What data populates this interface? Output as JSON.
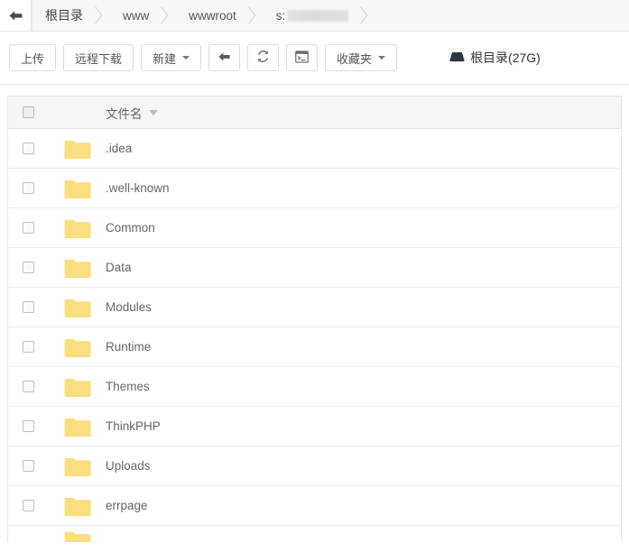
{
  "breadcrumb": {
    "back_icon": "arrow-left-icon",
    "items": [
      {
        "label": "根目录",
        "redacted": false
      },
      {
        "label": "www",
        "redacted": false
      },
      {
        "label": "wwwroot",
        "redacted": false
      },
      {
        "label": "s:",
        "redacted": true
      }
    ]
  },
  "toolbar": {
    "upload_label": "上传",
    "remote_download_label": "远程下载",
    "new_label": "新建",
    "back_icon": "arrow-left-icon",
    "refresh_icon": "refresh-icon",
    "terminal_icon": "terminal-icon",
    "favorites_label": "收藏夹",
    "disk_icon": "hard-drive-icon",
    "disk_label": "根目录(27G)"
  },
  "table": {
    "header": {
      "select_all": "select-all-checkbox",
      "filename_label": "文件名"
    },
    "rows": [
      {
        "name": ".idea",
        "icon": "folder-icon"
      },
      {
        "name": ".well-known",
        "icon": "folder-icon"
      },
      {
        "name": "Common",
        "icon": "folder-icon"
      },
      {
        "name": "Data",
        "icon": "folder-icon"
      },
      {
        "name": "Modules",
        "icon": "folder-icon"
      },
      {
        "name": "Runtime",
        "icon": "folder-icon"
      },
      {
        "name": "Themes",
        "icon": "folder-icon"
      },
      {
        "name": "ThinkPHP",
        "icon": "folder-icon"
      },
      {
        "name": "Uploads",
        "icon": "folder-icon"
      },
      {
        "name": "errpage",
        "icon": "folder-icon"
      }
    ]
  },
  "colors": {
    "folder_fill": "#fade7f",
    "folder_tab": "#f7d86a",
    "header_bg": "#f5f5f5",
    "border": "#e6e6e6",
    "text": "#666666"
  }
}
